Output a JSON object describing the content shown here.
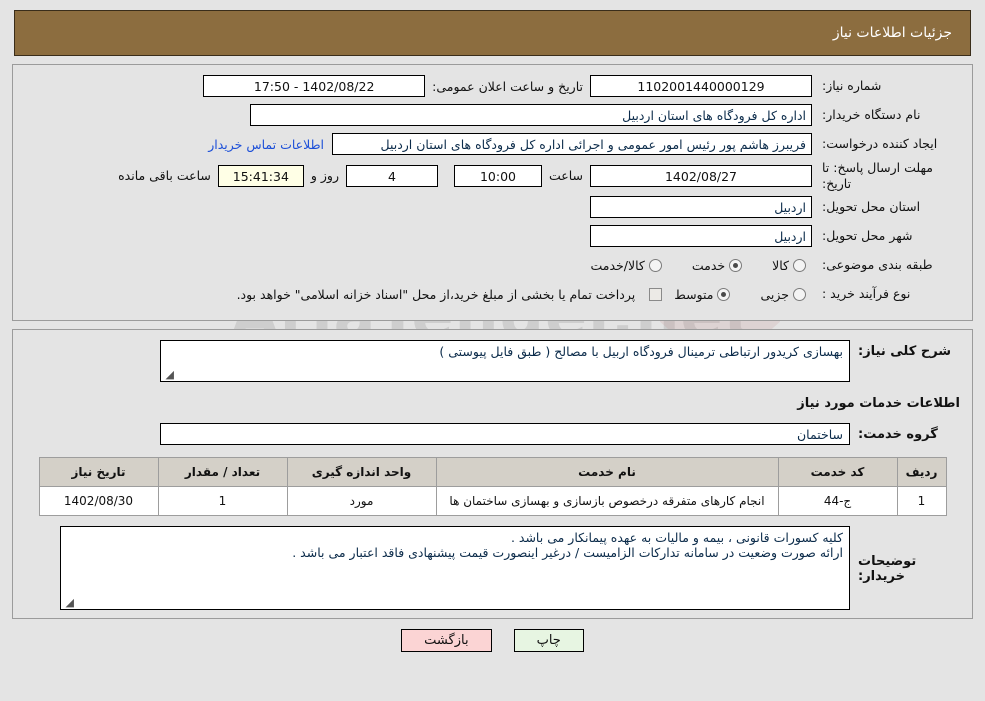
{
  "header": {
    "title": "جزئیات اطلاعات نیاز"
  },
  "watermark": {
    "text": "AriaTender.net"
  },
  "form": {
    "need_number": {
      "label": "شماره نیاز:",
      "value": "1102001440000129"
    },
    "announce": {
      "label": "تاریخ و ساعت اعلان عمومی:",
      "value": "17:50 - 1402/08/22"
    },
    "buyer_org": {
      "label": "نام دستگاه خریدار:",
      "value": "اداره کل فرودگاه های استان اردبیل"
    },
    "creator": {
      "label": "ایجاد کننده درخواست:",
      "value": "فریبرز هاشم پور رئیس امور عمومی و اجرائی اداره کل فرودگاه های استان اردبیل",
      "link": "اطلاعات تماس خریدار"
    },
    "deadline": {
      "label": "مهلت ارسال پاسخ: تا تاریخ:",
      "date": "1402/08/27",
      "hour_label": "ساعت",
      "hour": "10:00",
      "days": "4",
      "days_label": "روز و",
      "countdown": "15:41:34",
      "remaining_label": "ساعت باقی مانده"
    },
    "province": {
      "label": "استان محل تحویل:",
      "value": "اردبیل"
    },
    "city": {
      "label": "شهر محل تحویل:",
      "value": "اردبیل"
    },
    "category": {
      "label": "طبقه بندی موضوعی:",
      "options": [
        "کالا",
        "خدمت",
        "کالا/خدمت"
      ],
      "selected": "خدمت"
    },
    "process_type": {
      "label": "نوع فرآیند خرید :",
      "options": [
        "جزیی",
        "متوسط"
      ],
      "selected": "متوسط",
      "checkbox_note": "پرداخت تمام یا بخشی از مبلغ خرید،از محل \"اسناد خزانه اسلامی\" خواهد بود.",
      "checkbox_checked": false
    }
  },
  "middle": {
    "summary": {
      "label": "شرح کلی نیاز:",
      "value": "بهسازی کریدور ارتباطی ترمینال فرودگاه اربیل با مصالح ( طبق فایل پیوستی )"
    },
    "services_heading": "اطلاعات خدمات مورد نیاز",
    "service_group": {
      "label": "گروه خدمت:",
      "value": "ساختمان"
    },
    "table": {
      "columns": [
        "ردیف",
        "کد خدمت",
        "نام خدمت",
        "واحد اندازه گیری",
        "تعداد / مقدار",
        "تاریخ نیاز"
      ],
      "rows": [
        {
          "row": "1",
          "code": "ج-44",
          "name": "انجام کارهای متفرقه درخصوص بازسازی و بهسازی ساختمان ها",
          "unit": "مورد",
          "qty": "1",
          "date": "1402/08/30"
        }
      ]
    },
    "buyer_notes": {
      "label": "توضیحات خریدار:",
      "line1": "کلیه کسورات قانونی ، بیمه و مالیات به عهده پیمانکار می باشد .",
      "line2": "ارائه صورت وضعیت در سامانه تدارکات الزامیست / درغیر اینصورت قیمت پیشنهادی فاقد اعتبار می باشد ."
    }
  },
  "buttons": {
    "print": "چاپ",
    "back": "بازگشت"
  },
  "colors": {
    "header_brown": "#8c6d3f",
    "page_bg": "#e4e4e4",
    "link_blue": "#1c4fd8",
    "countdown_bg": "#ffffe6",
    "table_header_bg": "#d4d0c8",
    "btn_print_bg": "#e7f5e2",
    "btn_back_bg": "#fbd4d4"
  }
}
